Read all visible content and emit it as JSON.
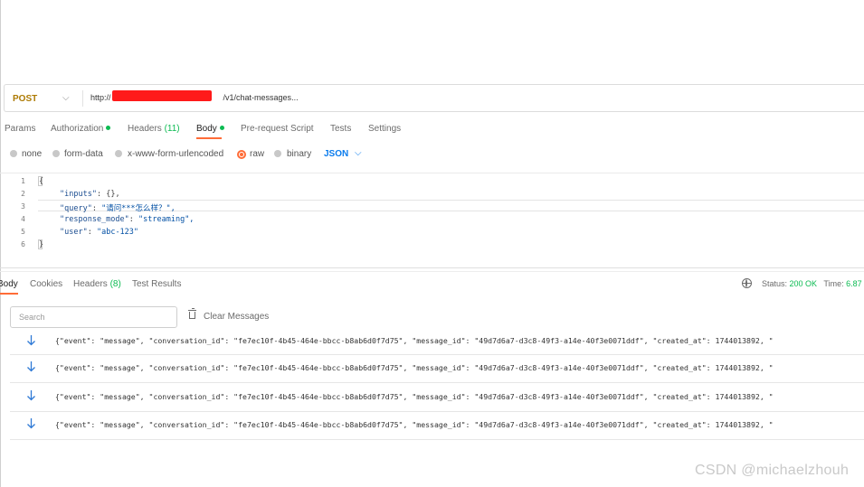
{
  "request": {
    "method": "POST",
    "url_prefix": "http://",
    "url_suffix": "/v1/chat-messages",
    "url_more": "..."
  },
  "tabs": [
    {
      "label": "Params"
    },
    {
      "label": "Authorization"
    },
    {
      "label": "Headers",
      "count": "(11)"
    },
    {
      "label": "Body"
    },
    {
      "label": "Pre-request Script"
    },
    {
      "label": "Tests"
    },
    {
      "label": "Settings"
    }
  ],
  "body_types": {
    "options": [
      "none",
      "form-data",
      "x-www-form-urlencoded",
      "raw",
      "binary"
    ],
    "selected": "raw",
    "format": "JSON"
  },
  "editor": {
    "line_numbers": [
      "1",
      "2",
      "3",
      "4",
      "5",
      "6"
    ],
    "open_brace": "{",
    "close_brace": "}",
    "lines": [
      {
        "key": "\"inputs\"",
        "value": "{},"
      },
      {
        "key": "\"query\"",
        "value": "\"请问***怎么样？\","
      },
      {
        "key": "\"response_mode\"",
        "value": "\"streaming\","
      },
      {
        "key": "\"user\"",
        "value": "\"abc-123\""
      }
    ]
  },
  "response": {
    "tabs": [
      {
        "label": "Body"
      },
      {
        "label": "Cookies"
      },
      {
        "label": "Headers",
        "count": "(8)"
      },
      {
        "label": "Test Results"
      }
    ],
    "status_label": "Status:",
    "status_value": "200 OK",
    "time_label": "Time:",
    "time_value": "6.87",
    "search_placeholder": "Search",
    "clear_label": "Clear Messages",
    "messages": [
      "{\"event\": \"message\", \"conversation_id\": \"fe7ec10f-4b45-464e-bbcc-b8ab6d0f7d75\", \"message_id\": \"49d7d6a7-d3c8-49f3-a14e-40f3e0071ddf\", \"created_at\": 1744013892, \"",
      "{\"event\": \"message\", \"conversation_id\": \"fe7ec10f-4b45-464e-bbcc-b8ab6d0f7d75\", \"message_id\": \"49d7d6a7-d3c8-49f3-a14e-40f3e0071ddf\", \"created_at\": 1744013892, \"",
      "{\"event\": \"message\", \"conversation_id\": \"fe7ec10f-4b45-464e-bbcc-b8ab6d0f7d75\", \"message_id\": \"49d7d6a7-d3c8-49f3-a14e-40f3e0071ddf\", \"created_at\": 1744013892, \"",
      "{\"event\": \"message\", \"conversation_id\": \"fe7ec10f-4b45-464e-bbcc-b8ab6d0f7d75\", \"message_id\": \"49d7d6a7-d3c8-49f3-a14e-40f3e0071ddf\", \"created_at\": 1744013892, \""
    ]
  },
  "watermark": "CSDN @michaelzhouh",
  "colors": {
    "accent": "#ff6c37",
    "method": "#ad7a03",
    "success": "#0cbb52",
    "link": "#097bed",
    "redaction": "#ff1a1a"
  }
}
